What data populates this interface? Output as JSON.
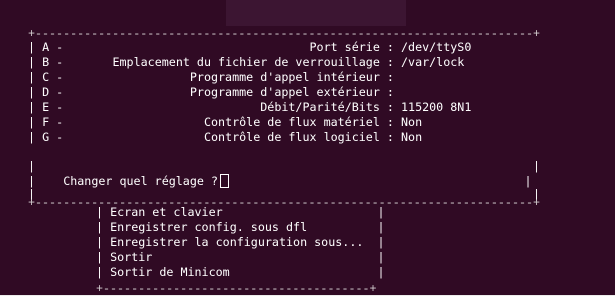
{
  "config_menu": {
    "top_border": "+-----------------------------------------------------------------------+",
    "rows": [
      {
        "key": "A",
        "label": "Port série",
        "value": "/dev/ttyS0"
      },
      {
        "key": "B",
        "label": "Emplacement du fichier de verrouillage",
        "value": "/var/lock"
      },
      {
        "key": "C",
        "label": "Programme d'appel intérieur",
        "value": ""
      },
      {
        "key": "D",
        "label": "Programme d'appel extérieur",
        "value": ""
      },
      {
        "key": "E",
        "label": "Débit/Parité/Bits",
        "value": "115200 8N1"
      },
      {
        "key": "F",
        "label": "Contrôle de flux matériel",
        "value": "Non"
      },
      {
        "key": "G",
        "label": "Contrôle de flux logiciel",
        "value": "Non"
      }
    ],
    "prompt": "Changer quel réglage ?",
    "bottom_border": "+-----------------------------------------------------------------------+"
  },
  "main_menu": {
    "items": [
      "Ecran et clavier",
      "Enregistrer config. sous dfl",
      "Enregistrer la configuration sous...",
      "Sortir",
      "Sortir de Minicom"
    ],
    "bottom_border": "+--------------------------------------+"
  }
}
